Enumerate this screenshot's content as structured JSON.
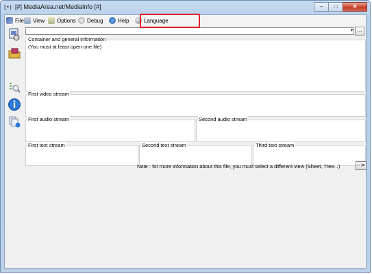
{
  "window": {
    "title": "[#] MediaArea.net/MediaInfo [#]",
    "app_icon_glyph": "[•)",
    "buttons": {
      "minimize": "‒",
      "maximize": "□",
      "close": "✕"
    }
  },
  "menu": {
    "items": [
      {
        "label": "File",
        "icon": "file-icon"
      },
      {
        "label": "View",
        "icon": "view-icon"
      },
      {
        "label": "Options",
        "icon": "options-icon"
      },
      {
        "label": "Debug",
        "icon": "debug-icon"
      },
      {
        "label": "Help",
        "icon": "help-icon"
      },
      {
        "label": "Language",
        "icon": "language-icon"
      }
    ]
  },
  "toolbar": {
    "combo_value": "",
    "combo_arrow": "▾",
    "combo_button": "..."
  },
  "sidebar": {
    "icons": [
      "open-file-icon",
      "open-folder-icon",
      "sheet-view-icon",
      "info-icon",
      "export-icon"
    ]
  },
  "panels": {
    "general": {
      "label": "Container and general information",
      "text": "(You must at least open one file)"
    },
    "video1": {
      "label": "First video stream"
    },
    "audio1": {
      "label": "First audio stream"
    },
    "audio2": {
      "label": "Second audio stream"
    },
    "text1": {
      "label": "First text stream"
    },
    "text2": {
      "label": "Second text stream"
    },
    "text3": {
      "label": "Third text stream"
    }
  },
  "note": {
    "text": "Note : for more information about this file, you must select a different view (Sheet, Tree...)",
    "button": "-->"
  },
  "colors": {
    "highlight_box": "#e0202a",
    "title_bar": "#c7dbf1",
    "close_button": "#c7412b"
  }
}
